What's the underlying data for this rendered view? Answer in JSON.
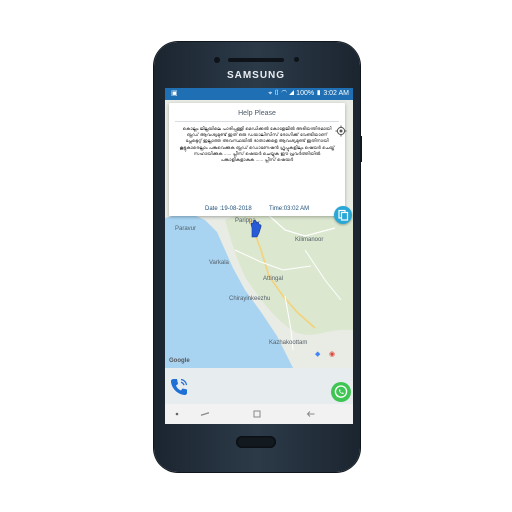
{
  "device": {
    "brand": "SAMSUNG"
  },
  "statusbar": {
    "battery": "100%",
    "time": "3:02 AM",
    "icons": [
      "image-icon",
      "location-icon",
      "vibrate-icon",
      "wifi-icon",
      "signal-icon",
      "battery-icon"
    ]
  },
  "map": {
    "labels": {
      "parippally": "Parippa...",
      "paravur": "Paravur",
      "kilimanoor": "Kilimanoor",
      "varkala": "Varkala",
      "attingal": "Attingal",
      "chirayinkeezhu": "Chirayinkeezhu",
      "kazhakoottam": "Kazhakoottam",
      "google": "Google"
    }
  },
  "dialog": {
    "title": "Help Please",
    "message": "കൊല്ലം ജില്ലയിലെ പാരിപ്പള്ളി മെഡിക്കൽ കോളേജിൽ അടിയന്തിരമായി ബ്ലഡ് ആവശ്യമുണ്ട് ഇത് ഒരു ഡയാലിസിസ് രോഗിക്ക് വേണ്ടിയാണ് പ്ലേറ്റ്ലെറ്റ് ഇല്ലാത്ത അവസ്ഥയിൽ ദാതാക്കളെ ആവശ്യമുണ്ട് ഇതിനായി കൂട്ടുകാരെല്ലാം പങ്കുവെക്കുക ബ്ലഡ് ഡൊണേഷൻ ഗ്രൂപ്പുകളിലും ഷെയർ ചെയ്ത് സഹായിക്കുക ...... പ്ലീസ് ഷെയർ ചെയ്യുക ഈ പ്രവർത്തിയിൽ പങ്കാളികളാകുക ...... പ്ലീസ് ഷെയർ",
    "date_label": "Date :19-08-2018",
    "time_label": "Time:03:02 AM"
  },
  "colors": {
    "statusbar": "#1e6fb3",
    "sea": "#a8d4f2",
    "fab": "#29a8d6",
    "whatsapp": "#3fc553",
    "call": "#1e6fd6"
  }
}
